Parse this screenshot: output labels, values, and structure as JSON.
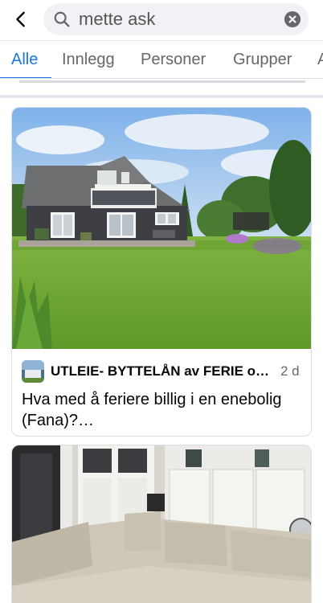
{
  "search": {
    "query": "mette ask",
    "back_icon": "arrow-left-icon",
    "search_icon": "magnifier-icon",
    "clear_icon": "close-circle-icon"
  },
  "tabs": [
    {
      "label": "Alle",
      "active": true
    },
    {
      "label": "Innlegg",
      "active": false
    },
    {
      "label": "Personer",
      "active": false
    },
    {
      "label": "Grupper",
      "active": false
    },
    {
      "label": "A",
      "active": false
    }
  ],
  "results": [
    {
      "group_name": "UTLEIE- BYTTELÅN av FERIE ob…",
      "age": "2 d",
      "text": "Hva med å feriere billig i en enebolig (Fana)?…"
    }
  ],
  "colors": {
    "accent": "#1b74e4",
    "secondary_text": "#65676b",
    "search_bg": "#f0f2f5"
  }
}
